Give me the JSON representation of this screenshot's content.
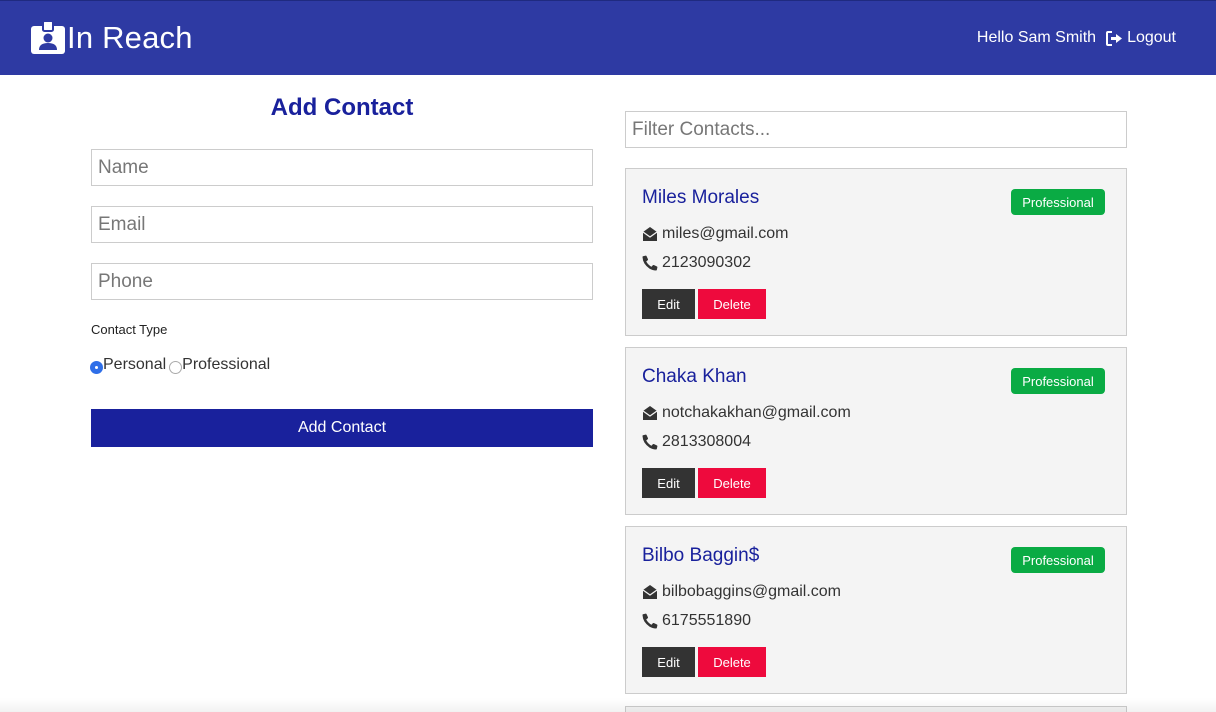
{
  "navbar": {
    "brand_title": "In Reach",
    "brand_icon": "id-badge-icon",
    "greeting": "Hello Sam Smith",
    "logout_label": "Logout",
    "logout_icon": "sign-out-icon",
    "background_color": "#2e3aa3"
  },
  "form": {
    "title": "Add Contact",
    "name_placeholder": "Name",
    "email_placeholder": "Email",
    "phone_placeholder": "Phone",
    "contact_type_label": "Contact Type",
    "type_options": [
      {
        "label": "Personal",
        "checked": true
      },
      {
        "label": "Professional",
        "checked": false
      }
    ],
    "submit_label": "Add Contact",
    "accent_color": "#19219c"
  },
  "contacts": {
    "filter_placeholder": "Filter Contacts...",
    "edit_label": "Edit",
    "delete_label": "Delete",
    "badge_color": "#0aab44",
    "delete_color": "#ee0a3d",
    "items": [
      {
        "name": "Miles Morales",
        "email": "miles@gmail.com",
        "phone": "2123090302",
        "type": "Professional"
      },
      {
        "name": "Chaka Khan",
        "email": "notchakakhan@gmail.com",
        "phone": "2813308004",
        "type": "Professional"
      },
      {
        "name": "Bilbo Baggin$",
        "email": "bilbobaggins@gmail.com",
        "phone": "6175551890",
        "type": "Professional"
      }
    ]
  }
}
